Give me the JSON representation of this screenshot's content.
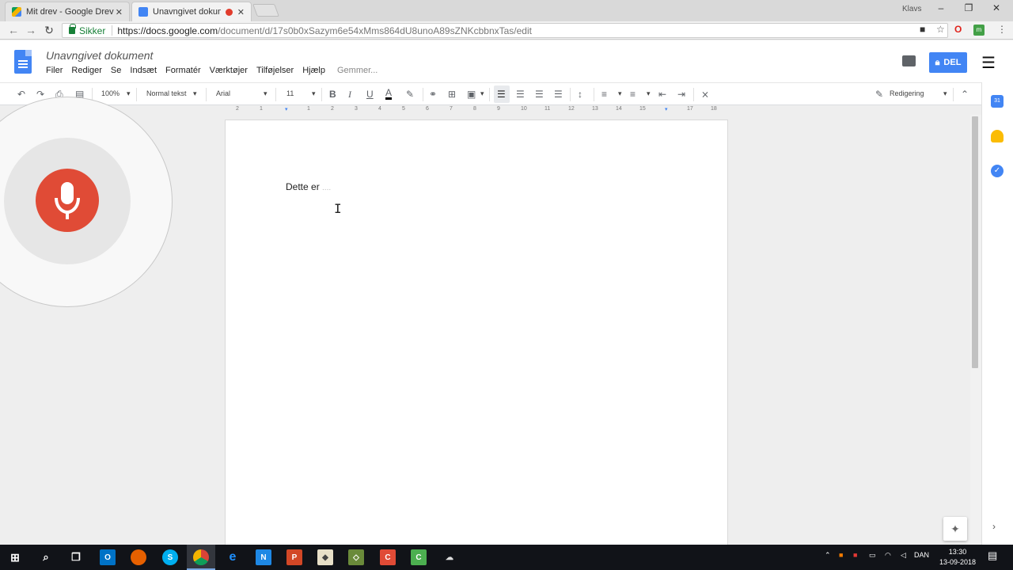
{
  "browser": {
    "tabs": [
      {
        "title": "Mit drev - Google Drev",
        "active": false
      },
      {
        "title": "Unavngivet dokument",
        "active": true,
        "recording": true
      }
    ],
    "profile_name": "Klavs",
    "secure_label": "Sikker",
    "url_base": "https://docs.google.com",
    "url_path": "/document/d/17s0b0xSazym6e54xMms864dU8unoA89sZNKcbbnxTas/edit"
  },
  "docs": {
    "title": "Unavngivet dokument",
    "menu": [
      "Filer",
      "Rediger",
      "Se",
      "Indsæt",
      "Formatér",
      "Værktøjer",
      "Tilføjelser",
      "Hjælp"
    ],
    "saving_status": "Gemmer...",
    "share_label": "DEL",
    "toolbar": {
      "zoom": "100%",
      "style": "Normal tekst",
      "font": "Arial",
      "font_size": "11",
      "mode": "Redigering"
    },
    "ruler_ticks": [
      "2",
      "1",
      "1",
      "2",
      "3",
      "4",
      "5",
      "6",
      "7",
      "8",
      "9",
      "10",
      "11",
      "12",
      "13",
      "14",
      "15",
      "16",
      "17",
      "18"
    ],
    "body_text": "Dette er",
    "interim_text": "....",
    "accent_color": "#4285f4",
    "mic_color": "#e04b36"
  },
  "taskbar": {
    "language": "DAN",
    "time": "13:30",
    "date": "13-09-2018"
  }
}
